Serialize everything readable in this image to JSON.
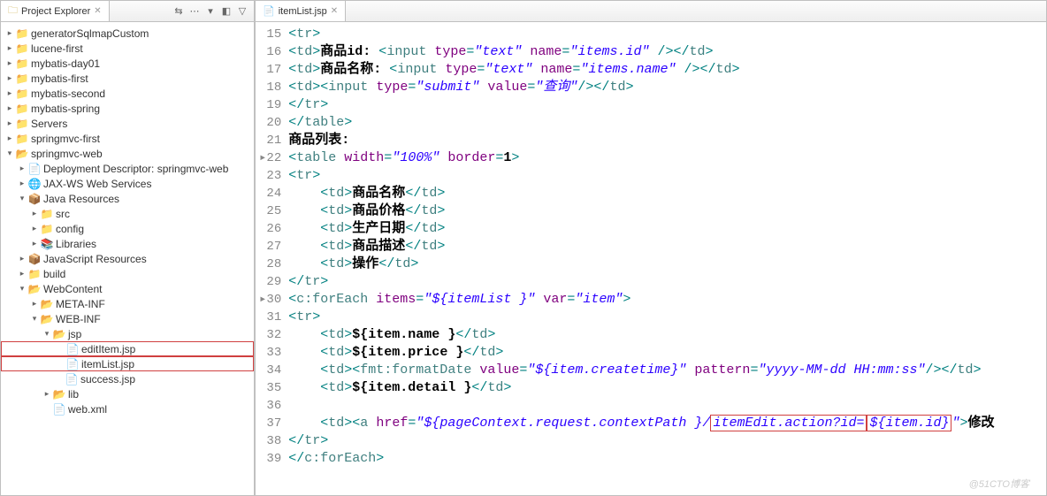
{
  "leftPanel": {
    "title": "Project Explorer",
    "toolbarIcons": [
      "⇆",
      "⋯",
      "▾",
      "◧",
      "▽"
    ],
    "tree": [
      {
        "indent": 0,
        "arrow": "▸",
        "icon": "📁",
        "cls": "ic-proj",
        "label": "generatorSqlmapCustom"
      },
      {
        "indent": 0,
        "arrow": "▸",
        "icon": "📁",
        "cls": "ic-proj",
        "label": "lucene-first"
      },
      {
        "indent": 0,
        "arrow": "▸",
        "icon": "📁",
        "cls": "ic-proj",
        "label": "mybatis-day01"
      },
      {
        "indent": 0,
        "arrow": "▸",
        "icon": "📁",
        "cls": "ic-proj",
        "label": "mybatis-first"
      },
      {
        "indent": 0,
        "arrow": "▸",
        "icon": "📁",
        "cls": "ic-proj",
        "label": "mybatis-second"
      },
      {
        "indent": 0,
        "arrow": "▸",
        "icon": "📁",
        "cls": "ic-proj",
        "label": "mybatis-spring"
      },
      {
        "indent": 0,
        "arrow": "▸",
        "icon": "📁",
        "cls": "ic-proj",
        "label": "Servers"
      },
      {
        "indent": 0,
        "arrow": "▸",
        "icon": "📁",
        "cls": "ic-proj",
        "label": "springmvc-first"
      },
      {
        "indent": 0,
        "arrow": "▾",
        "icon": "📂",
        "cls": "ic-proj",
        "label": "springmvc-web"
      },
      {
        "indent": 1,
        "arrow": "▸",
        "icon": "📄",
        "cls": "ic-file",
        "label": "Deployment Descriptor: springmvc-web"
      },
      {
        "indent": 1,
        "arrow": "▸",
        "icon": "🌐",
        "cls": "ic-file",
        "label": "JAX-WS Web Services"
      },
      {
        "indent": 1,
        "arrow": "▾",
        "icon": "📦",
        "cls": "ic-pkg",
        "label": "Java Resources"
      },
      {
        "indent": 2,
        "arrow": "▸",
        "icon": "📁",
        "cls": "ic-pkg",
        "label": "src"
      },
      {
        "indent": 2,
        "arrow": "▸",
        "icon": "📁",
        "cls": "ic-pkg",
        "label": "config"
      },
      {
        "indent": 2,
        "arrow": "▸",
        "icon": "📚",
        "cls": "ic-file",
        "label": "Libraries"
      },
      {
        "indent": 1,
        "arrow": "▸",
        "icon": "📦",
        "cls": "ic-file",
        "label": "JavaScript Resources"
      },
      {
        "indent": 1,
        "arrow": "▸",
        "icon": "📁",
        "cls": "ic-folder",
        "label": "build"
      },
      {
        "indent": 1,
        "arrow": "▾",
        "icon": "📂",
        "cls": "ic-folder",
        "label": "WebContent"
      },
      {
        "indent": 2,
        "arrow": "▸",
        "icon": "📂",
        "cls": "ic-folder",
        "label": "META-INF"
      },
      {
        "indent": 2,
        "arrow": "▾",
        "icon": "📂",
        "cls": "ic-folder",
        "label": "WEB-INF"
      },
      {
        "indent": 3,
        "arrow": "▾",
        "icon": "📂",
        "cls": "ic-folder",
        "label": "jsp"
      },
      {
        "indent": 4,
        "arrow": " ",
        "icon": "📄",
        "cls": "ic-jsp",
        "label": "editItem.jsp",
        "hl": true
      },
      {
        "indent": 4,
        "arrow": " ",
        "icon": "📄",
        "cls": "ic-jsp",
        "label": "itemList.jsp",
        "hl": true
      },
      {
        "indent": 4,
        "arrow": " ",
        "icon": "📄",
        "cls": "ic-jsp",
        "label": "success.jsp"
      },
      {
        "indent": 3,
        "arrow": "▸",
        "icon": "📂",
        "cls": "ic-folder",
        "label": "lib"
      },
      {
        "indent": 3,
        "arrow": " ",
        "icon": "📄",
        "cls": "ic-file",
        "label": "web.xml"
      }
    ]
  },
  "editor": {
    "tabTitle": "itemList.jsp",
    "startLine": 15,
    "lines": [
      {
        "tokens": [
          [
            "tag-bracket",
            "<"
          ],
          [
            "tag-name",
            "tr"
          ],
          [
            "tag-bracket",
            ">"
          ]
        ]
      },
      {
        "tokens": [
          [
            "tag-bracket",
            "<"
          ],
          [
            "tag-name",
            "td"
          ],
          [
            "tag-bracket",
            ">"
          ],
          [
            "plain",
            "商品id: "
          ],
          [
            "tag-bracket",
            "<"
          ],
          [
            "tag-name",
            "input"
          ],
          [
            "plain",
            " "
          ],
          [
            "attr-name",
            "type"
          ],
          [
            "tag-bracket",
            "="
          ],
          [
            "attr-value",
            "\"text\""
          ],
          [
            "plain",
            " "
          ],
          [
            "attr-name",
            "name"
          ],
          [
            "tag-bracket",
            "="
          ],
          [
            "attr-value",
            "\"items.id\""
          ],
          [
            "plain",
            " "
          ],
          [
            "tag-bracket",
            "/></"
          ],
          [
            "tag-name",
            "td"
          ],
          [
            "tag-bracket",
            ">"
          ]
        ]
      },
      {
        "tokens": [
          [
            "tag-bracket",
            "<"
          ],
          [
            "tag-name",
            "td"
          ],
          [
            "tag-bracket",
            ">"
          ],
          [
            "plain",
            "商品名称: "
          ],
          [
            "tag-bracket",
            "<"
          ],
          [
            "tag-name",
            "input"
          ],
          [
            "plain",
            " "
          ],
          [
            "attr-name",
            "type"
          ],
          [
            "tag-bracket",
            "="
          ],
          [
            "attr-value",
            "\"text\""
          ],
          [
            "plain",
            " "
          ],
          [
            "attr-name",
            "name"
          ],
          [
            "tag-bracket",
            "="
          ],
          [
            "attr-value",
            "\"items.name\""
          ],
          [
            "plain",
            " "
          ],
          [
            "tag-bracket",
            "/></"
          ],
          [
            "tag-name",
            "td"
          ],
          [
            "tag-bracket",
            ">"
          ]
        ]
      },
      {
        "tokens": [
          [
            "tag-bracket",
            "<"
          ],
          [
            "tag-name",
            "td"
          ],
          [
            "tag-bracket",
            "><"
          ],
          [
            "tag-name",
            "input"
          ],
          [
            "plain",
            " "
          ],
          [
            "attr-name",
            "type"
          ],
          [
            "tag-bracket",
            "="
          ],
          [
            "attr-value",
            "\"submit\""
          ],
          [
            "plain",
            " "
          ],
          [
            "attr-name",
            "value"
          ],
          [
            "tag-bracket",
            "="
          ],
          [
            "attr-value",
            "\"查询\""
          ],
          [
            "tag-bracket",
            "/></"
          ],
          [
            "tag-name",
            "td"
          ],
          [
            "tag-bracket",
            ">"
          ]
        ]
      },
      {
        "tokens": [
          [
            "tag-bracket",
            "</"
          ],
          [
            "tag-name",
            "tr"
          ],
          [
            "tag-bracket",
            ">"
          ]
        ]
      },
      {
        "tokens": [
          [
            "tag-bracket",
            "</"
          ],
          [
            "tag-name",
            "table"
          ],
          [
            "tag-bracket",
            ">"
          ]
        ]
      },
      {
        "tokens": [
          [
            "plain",
            "商品列表:"
          ]
        ]
      },
      {
        "marker": "▸",
        "tokens": [
          [
            "tag-bracket",
            "<"
          ],
          [
            "tag-name",
            "table"
          ],
          [
            "plain",
            " "
          ],
          [
            "attr-name",
            "width"
          ],
          [
            "tag-bracket",
            "="
          ],
          [
            "attr-value",
            "\"100%\""
          ],
          [
            "plain",
            " "
          ],
          [
            "attr-name",
            "border"
          ],
          [
            "tag-bracket",
            "="
          ],
          [
            "plain",
            "1"
          ],
          [
            "tag-bracket",
            ">"
          ]
        ]
      },
      {
        "tokens": [
          [
            "tag-bracket",
            "<"
          ],
          [
            "tag-name",
            "tr"
          ],
          [
            "tag-bracket",
            ">"
          ]
        ]
      },
      {
        "tokens": [
          [
            "plain",
            "    "
          ],
          [
            "tag-bracket",
            "<"
          ],
          [
            "tag-name",
            "td"
          ],
          [
            "tag-bracket",
            ">"
          ],
          [
            "plain",
            "商品名称"
          ],
          [
            "tag-bracket",
            "</"
          ],
          [
            "tag-name",
            "td"
          ],
          [
            "tag-bracket",
            ">"
          ]
        ]
      },
      {
        "tokens": [
          [
            "plain",
            "    "
          ],
          [
            "tag-bracket",
            "<"
          ],
          [
            "tag-name",
            "td"
          ],
          [
            "tag-bracket",
            ">"
          ],
          [
            "plain",
            "商品价格"
          ],
          [
            "tag-bracket",
            "</"
          ],
          [
            "tag-name",
            "td"
          ],
          [
            "tag-bracket",
            ">"
          ]
        ]
      },
      {
        "tokens": [
          [
            "plain",
            "    "
          ],
          [
            "tag-bracket",
            "<"
          ],
          [
            "tag-name",
            "td"
          ],
          [
            "tag-bracket",
            ">"
          ],
          [
            "plain",
            "生产日期"
          ],
          [
            "tag-bracket",
            "</"
          ],
          [
            "tag-name",
            "td"
          ],
          [
            "tag-bracket",
            ">"
          ]
        ]
      },
      {
        "tokens": [
          [
            "plain",
            "    "
          ],
          [
            "tag-bracket",
            "<"
          ],
          [
            "tag-name",
            "td"
          ],
          [
            "tag-bracket",
            ">"
          ],
          [
            "plain",
            "商品描述"
          ],
          [
            "tag-bracket",
            "</"
          ],
          [
            "tag-name",
            "td"
          ],
          [
            "tag-bracket",
            ">"
          ]
        ]
      },
      {
        "tokens": [
          [
            "plain",
            "    "
          ],
          [
            "tag-bracket",
            "<"
          ],
          [
            "tag-name",
            "td"
          ],
          [
            "tag-bracket",
            ">"
          ],
          [
            "plain",
            "操作"
          ],
          [
            "tag-bracket",
            "</"
          ],
          [
            "tag-name",
            "td"
          ],
          [
            "tag-bracket",
            ">"
          ]
        ]
      },
      {
        "tokens": [
          [
            "tag-bracket",
            "</"
          ],
          [
            "tag-name",
            "tr"
          ],
          [
            "tag-bracket",
            ">"
          ]
        ]
      },
      {
        "marker": "▸",
        "tokens": [
          [
            "tag-bracket",
            "<"
          ],
          [
            "tag-name",
            "c:forEach"
          ],
          [
            "plain",
            " "
          ],
          [
            "attr-name",
            "items"
          ],
          [
            "tag-bracket",
            "="
          ],
          [
            "attr-value",
            "\"${itemList }\""
          ],
          [
            "plain",
            " "
          ],
          [
            "attr-name",
            "var"
          ],
          [
            "tag-bracket",
            "="
          ],
          [
            "attr-value",
            "\"item\""
          ],
          [
            "tag-bracket",
            ">"
          ]
        ]
      },
      {
        "tokens": [
          [
            "tag-bracket",
            "<"
          ],
          [
            "tag-name",
            "tr"
          ],
          [
            "tag-bracket",
            ">"
          ]
        ]
      },
      {
        "tokens": [
          [
            "plain",
            "    "
          ],
          [
            "tag-bracket",
            "<"
          ],
          [
            "tag-name",
            "td"
          ],
          [
            "tag-bracket",
            ">"
          ],
          [
            "el-expr",
            "${item.name }"
          ],
          [
            "tag-bracket",
            "</"
          ],
          [
            "tag-name",
            "td"
          ],
          [
            "tag-bracket",
            ">"
          ]
        ]
      },
      {
        "tokens": [
          [
            "plain",
            "    "
          ],
          [
            "tag-bracket",
            "<"
          ],
          [
            "tag-name",
            "td"
          ],
          [
            "tag-bracket",
            ">"
          ],
          [
            "el-expr",
            "${item.price }"
          ],
          [
            "tag-bracket",
            "</"
          ],
          [
            "tag-name",
            "td"
          ],
          [
            "tag-bracket",
            ">"
          ]
        ]
      },
      {
        "tokens": [
          [
            "plain",
            "    "
          ],
          [
            "tag-bracket",
            "<"
          ],
          [
            "tag-name",
            "td"
          ],
          [
            "tag-bracket",
            "><"
          ],
          [
            "tag-name",
            "fmt:formatDate"
          ],
          [
            "plain",
            " "
          ],
          [
            "attr-name",
            "value"
          ],
          [
            "tag-bracket",
            "="
          ],
          [
            "attr-value",
            "\"${item.createtime}\""
          ],
          [
            "plain",
            " "
          ],
          [
            "attr-name",
            "pattern"
          ],
          [
            "tag-bracket",
            "="
          ],
          [
            "attr-value",
            "\"yyyy-MM-dd HH:mm:ss\""
          ],
          [
            "tag-bracket",
            "/></"
          ],
          [
            "tag-name",
            "td"
          ],
          [
            "tag-bracket",
            ">"
          ]
        ]
      },
      {
        "tokens": [
          [
            "plain",
            "    "
          ],
          [
            "tag-bracket",
            "<"
          ],
          [
            "tag-name",
            "td"
          ],
          [
            "tag-bracket",
            ">"
          ],
          [
            "el-expr",
            "${item.detail }"
          ],
          [
            "tag-bracket",
            "</"
          ],
          [
            "tag-name",
            "td"
          ],
          [
            "tag-bracket",
            ">"
          ]
        ]
      },
      {
        "tokens": []
      },
      {
        "tokens": [
          [
            "plain",
            "    "
          ],
          [
            "tag-bracket",
            "<"
          ],
          [
            "tag-name",
            "td"
          ],
          [
            "tag-bracket",
            "><"
          ],
          [
            "tag-name",
            "a"
          ],
          [
            "plain",
            " "
          ],
          [
            "attr-name",
            "href"
          ],
          [
            "tag-bracket",
            "="
          ],
          [
            "attr-value",
            "\"${pageContext.request.contextPath }"
          ],
          [
            "attr-value",
            "/"
          ],
          [
            "attr-value-box",
            "itemEdit.action?id="
          ],
          [
            "attr-value-box2",
            "${item.id}"
          ],
          [
            "attr-value",
            "\""
          ],
          [
            "tag-bracket",
            ">"
          ],
          [
            "plain",
            "修改"
          ]
        ]
      },
      {
        "tokens": [
          [
            "tag-bracket",
            "</"
          ],
          [
            "tag-name",
            "tr"
          ],
          [
            "tag-bracket",
            ">"
          ]
        ]
      },
      {
        "tokens": [
          [
            "tag-bracket",
            "</"
          ],
          [
            "tag-name",
            "c:forEach"
          ],
          [
            "tag-bracket",
            ">"
          ]
        ]
      }
    ]
  },
  "watermark": "@51CTO博客"
}
